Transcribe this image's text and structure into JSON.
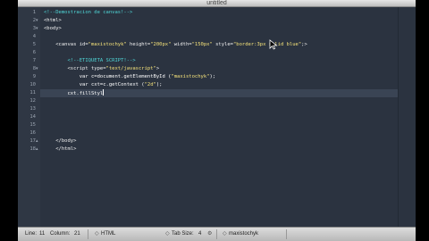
{
  "window": {
    "title": "untitled"
  },
  "gutter": {
    "line_numbers": [
      "1",
      "2",
      "3",
      "4",
      "5",
      "6",
      "7",
      "8",
      "9",
      "10",
      "11",
      "12",
      "13",
      "14",
      "15",
      "16",
      "17",
      "18"
    ]
  },
  "code": {
    "lines": [
      [
        {
          "t": "<!--Demostracion de canvas!-->",
          "c": "comment"
        }
      ],
      [
        {
          "t": "<html>",
          "c": "tag"
        }
      ],
      [
        {
          "t": "<body>",
          "c": "tag"
        }
      ],
      [
        {
          "t": "",
          "c": "plain"
        }
      ],
      [
        {
          "t": "    <canvas id=",
          "c": "tag"
        },
        {
          "t": "\"maxistochyk\"",
          "c": "string"
        },
        {
          "t": " height=",
          "c": "attr"
        },
        {
          "t": "\"200px\"",
          "c": "string"
        },
        {
          "t": " width=",
          "c": "attr"
        },
        {
          "t": "\"150px\"",
          "c": "string"
        },
        {
          "t": " style=",
          "c": "attr"
        },
        {
          "t": "\"border:3px solid blue\"",
          "c": "string"
        },
        {
          "t": ";>",
          "c": "tag"
        }
      ],
      [
        {
          "t": "",
          "c": "plain"
        }
      ],
      [
        {
          "t": "        <!--ETIQUETA SCRIPT!-->",
          "c": "comment"
        }
      ],
      [
        {
          "t": "        <script type=",
          "c": "tag"
        },
        {
          "t": "\"text/javascript\"",
          "c": "string"
        },
        {
          "t": ">",
          "c": "tag"
        }
      ],
      [
        {
          "t": "            var c=document.getElementById (",
          "c": "plain"
        },
        {
          "t": "\"maxistochyk\"",
          "c": "string"
        },
        {
          "t": ");",
          "c": "plain"
        }
      ],
      [
        {
          "t": "            var cxt=c.getContext (",
          "c": "plain"
        },
        {
          "t": "\"2d\"",
          "c": "string"
        },
        {
          "t": ");",
          "c": "plain"
        }
      ],
      [
        {
          "t": "        cxt.fillStyl",
          "c": "plain"
        }
      ],
      [
        {
          "t": "",
          "c": "plain"
        }
      ],
      [
        {
          "t": "",
          "c": "plain"
        }
      ],
      [
        {
          "t": "",
          "c": "plain"
        }
      ],
      [
        {
          "t": "",
          "c": "plain"
        }
      ],
      [
        {
          "t": "",
          "c": "plain"
        }
      ],
      [
        {
          "t": "    </body>",
          "c": "tag"
        }
      ],
      [
        {
          "t": "    </html>",
          "c": "tag"
        }
      ]
    ],
    "current_line_index": 10
  },
  "status": {
    "line_label": "Line:",
    "line_value": "11",
    "column_label": "Column:",
    "column_value": "21",
    "syntax": "HTML",
    "tab_size_label": "Tab Size:",
    "tab_size_value": "4",
    "symbol": "maxistochyk"
  }
}
